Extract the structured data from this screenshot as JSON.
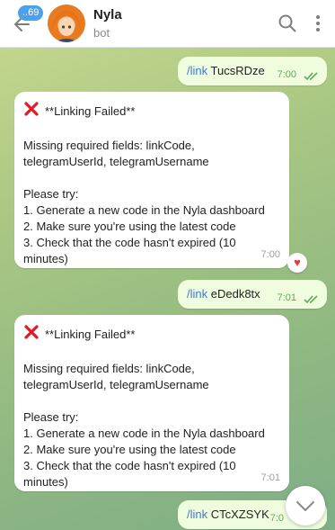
{
  "header": {
    "unread_badge": "..69",
    "title": "Nyla",
    "subtitle": "bot"
  },
  "messages": {
    "out1": {
      "command": "/link",
      "arg": "TucsRDze",
      "time": "7:00"
    },
    "in1": {
      "headline": "**Linking Failed**",
      "missing": [
        "Missing required fields: linkCode,",
        "telegramUserId, telegramUsername"
      ],
      "please": "Please try:",
      "steps": [
        "1. Generate a new code in the Nyla dashboard",
        "2. Make sure you're using the latest code",
        "3. Check that the code hasn't expired (10",
        "minutes)"
      ],
      "time": "7:00",
      "reaction": "♥"
    },
    "out2": {
      "command": "/link",
      "arg": "eDedk8tx",
      "time": "7:01"
    },
    "in2": {
      "headline": "**Linking Failed**",
      "missing": [
        "Missing required fields: linkCode,",
        "telegramUserId, telegramUsername"
      ],
      "please": "Please try:",
      "steps": [
        "1. Generate a new code in the Nyla dashboard",
        "2. Make sure you're using the latest code",
        "3. Check that the code hasn't expired (10",
        "minutes)"
      ],
      "time": "7:01"
    },
    "out3": {
      "command": "/link",
      "arg": "CTcXZSYK",
      "time": "7:0"
    }
  },
  "colors": {
    "accent": "#4da1e8",
    "outgoing_bubble": "#effdde",
    "check_green": "#64a65c",
    "error_red": "#e53935"
  }
}
